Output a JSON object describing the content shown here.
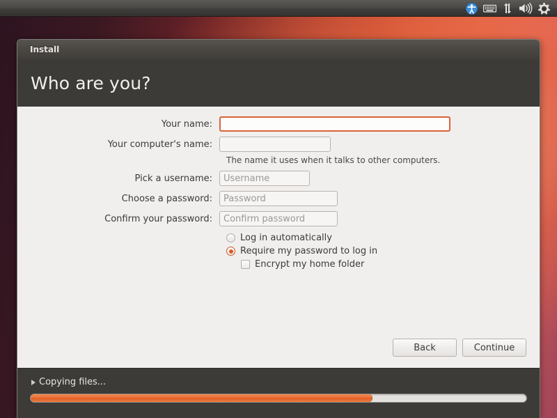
{
  "panel": {
    "tray": [
      {
        "name": "accessibility-icon",
        "label": "Accessibility"
      },
      {
        "name": "keyboard-icon",
        "label": "Keyboard layout"
      },
      {
        "name": "network-icon",
        "label": "Network"
      },
      {
        "name": "volume-icon",
        "label": "Volume"
      },
      {
        "name": "settings-gear-icon",
        "label": "System settings"
      }
    ]
  },
  "window": {
    "title": "Install",
    "heading": "Who are you?"
  },
  "form": {
    "fields": [
      {
        "label": "Your name:",
        "value": "",
        "placeholder": "",
        "focused": true
      },
      {
        "label": "Your computer's name:",
        "value": "",
        "placeholder": "",
        "focused": false,
        "helper": "The name it uses when it talks to other computers."
      },
      {
        "label": "Pick a username:",
        "value": "",
        "placeholder": "Username",
        "focused": false
      },
      {
        "label": "Choose a password:",
        "value": "",
        "placeholder": "Password",
        "focused": false
      },
      {
        "label": "Confirm your password:",
        "value": "",
        "placeholder": "Confirm password",
        "focused": false
      }
    ],
    "helper_text": "The name it uses when it talks to other computers.",
    "login_options": [
      {
        "label": "Log in automatically",
        "selected": false
      },
      {
        "label": "Require my password to log in",
        "selected": true
      }
    ],
    "encrypt_option": {
      "label": "Encrypt my home folder",
      "checked": false
    }
  },
  "buttons": {
    "back": "Back",
    "continue": "Continue"
  },
  "progress": {
    "label": "Copying files...",
    "percent": 69
  },
  "colors": {
    "accent_orange": "#df6129",
    "focus_border": "#d8633a",
    "dark_chrome": "#3c3b37",
    "content_bg": "#f1efed"
  }
}
